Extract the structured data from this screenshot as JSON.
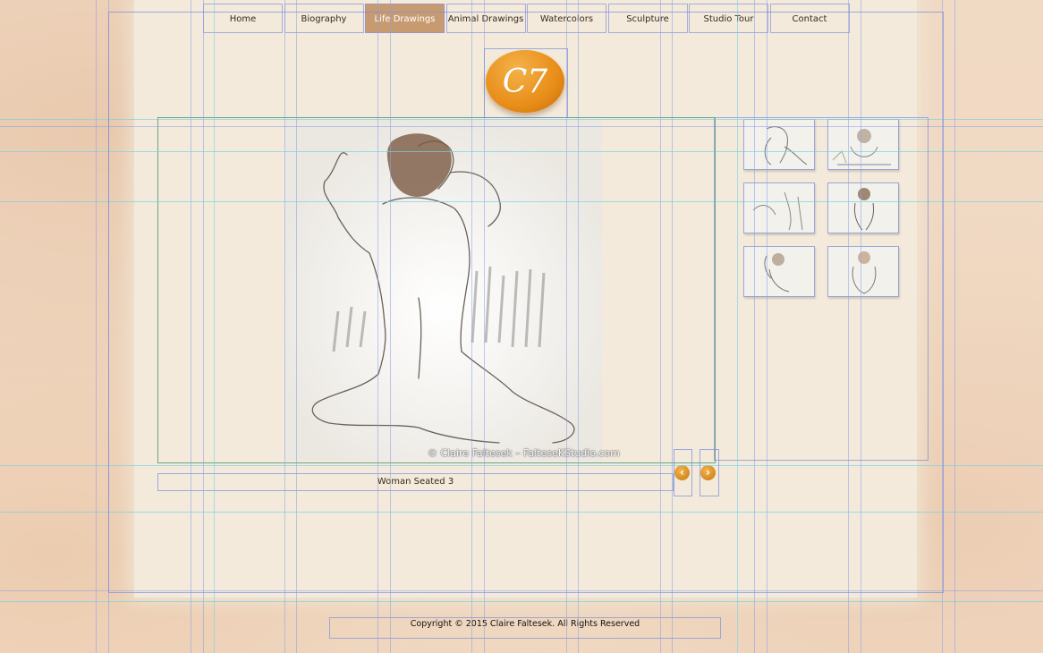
{
  "nav": {
    "items": [
      {
        "label": "Home"
      },
      {
        "label": "Biography"
      },
      {
        "label": "Life Drawings"
      },
      {
        "label": "Animal Drawings"
      },
      {
        "label": "Watercolors"
      },
      {
        "label": "Sculpture"
      },
      {
        "label": "Studio Tour"
      },
      {
        "label": "Contact"
      }
    ],
    "active": "Life Drawings"
  },
  "logo": {
    "text": "C7"
  },
  "main_image": {
    "credit": "© Claire Faltesek – FalteseKStudio.com",
    "caption": "Woman Seated 3"
  },
  "gallery": {
    "prev_icon": "chevron-left-icon",
    "next_icon": "chevron-right-icon",
    "thumbnails": [
      {
        "label": "thumbnail-1"
      },
      {
        "label": "thumbnail-2"
      },
      {
        "label": "thumbnail-3"
      },
      {
        "label": "thumbnail-4"
      },
      {
        "label": "thumbnail-5"
      },
      {
        "label": "thumbnail-6"
      }
    ]
  },
  "footer": {
    "copyright": "Copyright © 2015 Claire Faltesek. All Rights Reserved"
  },
  "colors": {
    "accent": "#c89a70",
    "orange": "#e88d18",
    "paper": "#f3eadb"
  }
}
